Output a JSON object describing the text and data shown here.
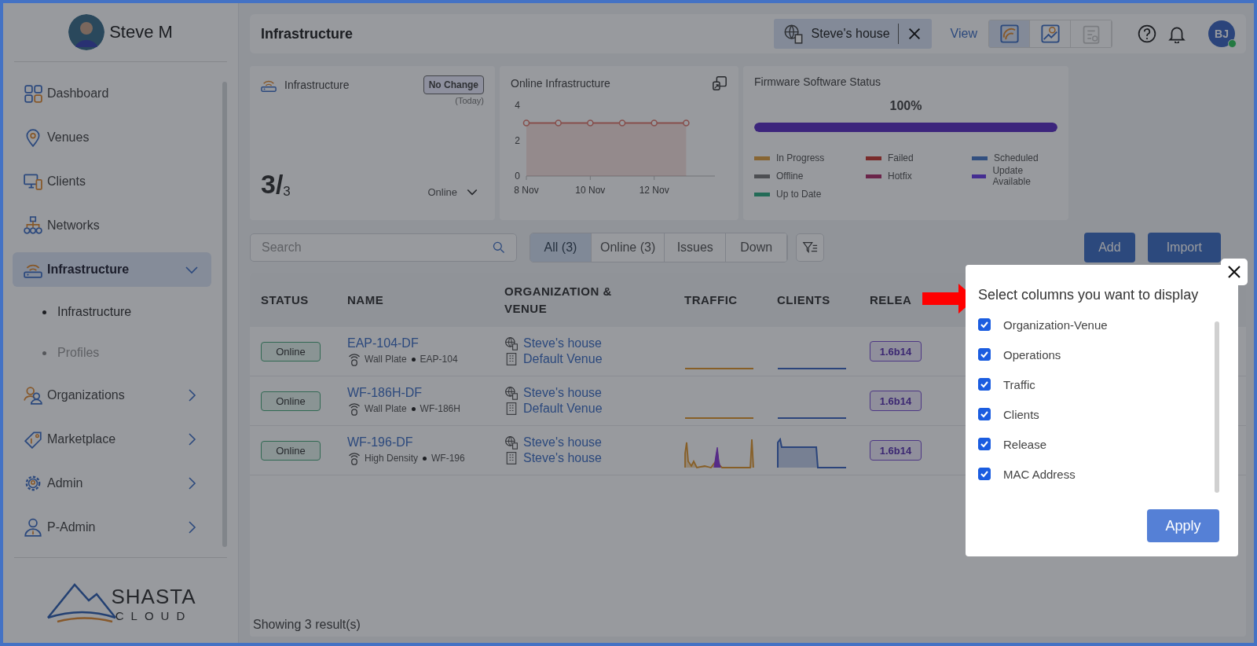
{
  "sidebar": {
    "user": {
      "name": "Steve M"
    },
    "items": [
      {
        "kind": "link",
        "label": "Dashboard",
        "selected": false
      },
      {
        "kind": "link",
        "label": "Venues",
        "selected": false
      },
      {
        "kind": "link",
        "label": "Clients",
        "selected": false
      },
      {
        "kind": "link",
        "label": "Networks",
        "selected": false
      },
      {
        "kind": "group",
        "label": "Infrastructure",
        "selected": true,
        "expanded": true,
        "children": [
          {
            "label": "Infrastructure",
            "selected": true
          },
          {
            "label": "Profiles",
            "selected": false
          }
        ]
      },
      {
        "kind": "group",
        "label": "Organizations",
        "selected": false,
        "expanded": false
      },
      {
        "kind": "group",
        "label": "Marketplace",
        "selected": false,
        "expanded": false
      },
      {
        "kind": "group",
        "label": "Admin",
        "selected": false,
        "expanded": false
      },
      {
        "kind": "group",
        "label": "P-Admin",
        "selected": false,
        "expanded": false
      }
    ],
    "logo": {
      "line_1": "SHASTA",
      "line_2": "CLOUD"
    }
  },
  "header": {
    "title": "Infrastructure",
    "context": "Steve's house",
    "view_label": "View",
    "views": [
      {
        "selected": true,
        "disabled": false
      },
      {
        "selected": false,
        "disabled": false
      },
      {
        "selected": false,
        "disabled": true
      }
    ],
    "user_initials": "BJ",
    "online": true
  },
  "cards": {
    "infrastructure": {
      "title": "Infrastructure",
      "badge": "No Change",
      "badge_note": "(Today)",
      "count": "3/",
      "total": "3",
      "filter": "Online"
    },
    "online": {
      "title": "Online Infrastructure",
      "chart_data": {
        "type": "area",
        "categories": [
          "8 Nov",
          null,
          "10 Nov",
          null,
          "12 Nov",
          null
        ],
        "ylim": [
          0,
          4
        ],
        "yticks": [
          0,
          2,
          4
        ],
        "series": [
          {
            "color": "#e07a6e",
            "values": [
              3,
              3,
              3,
              3,
              3,
              3
            ]
          }
        ]
      }
    },
    "firmware": {
      "title": "Firmware Software Status",
      "percent": "100%",
      "level": 1,
      "legend": [
        {
          "label": "In Progress",
          "color": "#866533"
        },
        {
          "label": "Failed",
          "color": "#792c2b"
        },
        {
          "label": "Scheduled",
          "color": "#324f7f"
        },
        {
          "label": "Offline",
          "color": "#4d5053"
        },
        {
          "label": "Hotfix",
          "color": "#6b264a"
        },
        {
          "label": "Update Available",
          "color": "#442e91"
        },
        {
          "label": "Up to Date",
          "color": "#236b57"
        }
      ]
    }
  },
  "toolbar": {
    "search": {
      "placeholder": "Search"
    },
    "filters": [
      {
        "label": "All (3)",
        "selected": true
      },
      {
        "label": "Online (3)",
        "selected": false
      },
      {
        "label": "Issues",
        "selected": false
      },
      {
        "label": "Down",
        "selected": false
      }
    ],
    "buttons": [
      "Add",
      "Import"
    ]
  },
  "table": {
    "columns": [
      "STATUS",
      "NAME",
      "ORGANIZATION & VENUE",
      "TRAFFIC",
      "CLIENTS",
      "RELEA"
    ],
    "rows": [
      {
        "status": "Online",
        "name": "EAP-104-DF",
        "type": "Wall Plate",
        "model": "EAP-104",
        "organization": "Steve's house",
        "venue": "Default Venue",
        "kind": "idle",
        "release": "1.6b14"
      },
      {
        "status": "Online",
        "name": "WF-186H-DF",
        "type": "Wall Plate",
        "model": "WF-186H",
        "organization": "Steve's house",
        "venue": "Default Venue",
        "kind": "idle",
        "release": "1.6b14"
      },
      {
        "status": "Online",
        "name": "WF-196-DF",
        "type": "High Density",
        "model": "WF-196",
        "organization": "Steve's house",
        "venue": "Steve's house",
        "kind": "busy",
        "release": "1.6b14"
      }
    ]
  },
  "footer": "Showing 3 result(s)",
  "dialog": {
    "title": "Select columns you want to display",
    "options": [
      {
        "label": "Organization-Venue",
        "checked": true
      },
      {
        "label": "Operations",
        "checked": true
      },
      {
        "label": "Traffic",
        "checked": true
      },
      {
        "label": "Clients",
        "checked": true
      },
      {
        "label": "Release",
        "checked": true
      },
      {
        "label": "MAC Address",
        "checked": true
      }
    ],
    "apply": "Apply"
  }
}
